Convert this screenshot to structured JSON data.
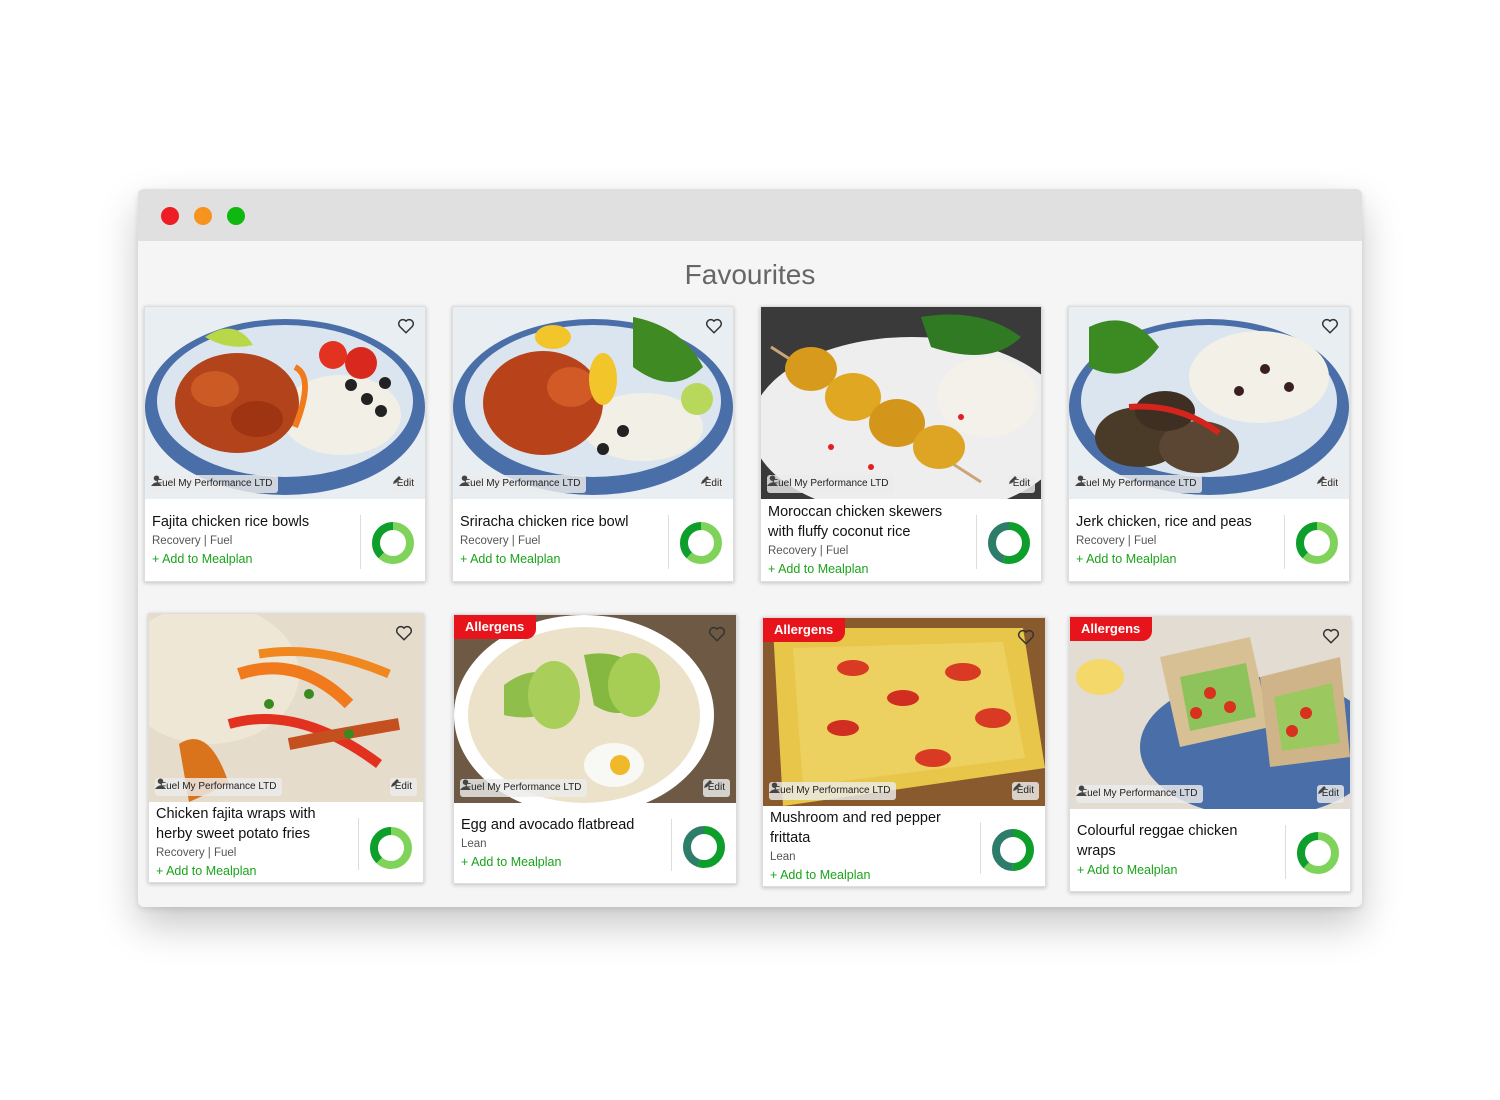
{
  "page": {
    "title": "Favourites"
  },
  "colors": {
    "accent_green": "#1aa31a",
    "allergen_red": "#e8141c",
    "donut_light": "#7fd35a",
    "donut_dark": "#0e9e2c",
    "donut_teal": "#2e7d6a"
  },
  "recipes": [
    {
      "title": "Fajita chicken rice bowls",
      "tags": "Recovery  |  Fuel",
      "author": "Fuel My Performance LTD",
      "edit": "Edit",
      "add": "+ Add to Mealplan",
      "favourite_icon": "heart-outline-icon",
      "nutrition_split": [
        0.62,
        0.38
      ]
    },
    {
      "title": "Sriracha chicken rice bowl",
      "tags": "Recovery  |  Fuel",
      "author": "Fuel My Performance LTD",
      "edit": "Edit",
      "add": "+ Add to Mealplan",
      "favourite_icon": "heart-outline-icon",
      "nutrition_split": [
        0.62,
        0.38
      ]
    },
    {
      "title": "Moroccan chicken skewers with fluffy coconut rice",
      "tags": "Recovery  |  Fuel",
      "author": "Fuel My Performance LTD",
      "edit": "Edit",
      "add": "+ Add to Mealplan",
      "favourite_icon": "heart-outline-icon",
      "nutrition_split": [
        0.55,
        0.45
      ]
    },
    {
      "title": "Jerk chicken, rice and peas",
      "tags": "Recovery  |  Fuel",
      "author": "Fuel My Performance LTD",
      "edit": "Edit",
      "add": "+ Add to Mealplan",
      "favourite_icon": "heart-outline-icon",
      "nutrition_split": [
        0.62,
        0.38
      ]
    },
    {
      "title": "Chicken fajita wraps with herby sweet potato fries",
      "tags": "Recovery  |  Fuel",
      "author": "Fuel My Performance LTD",
      "edit": "Edit",
      "add": "+ Add to Mealplan",
      "favourite_icon": "heart-outline-icon",
      "nutrition_split": [
        0.62,
        0.38
      ]
    },
    {
      "title": "Egg and avocado flatbread",
      "tags": "Lean",
      "author": "Fuel My Performance LTD",
      "edit": "Edit",
      "add": "+ Add to Mealplan",
      "allergens": "Allergens",
      "favourite_icon": "heart-outline-icon",
      "nutrition_split": [
        0.55,
        0.45
      ]
    },
    {
      "title": "Mushroom and red pepper frittata",
      "tags": "Lean",
      "author": "Fuel My Performance LTD",
      "edit": "Edit",
      "add": "+ Add to Mealplan",
      "allergens": "Allergens",
      "favourite_icon": "heart-outline-icon",
      "nutrition_split": [
        0.5,
        0.5
      ]
    },
    {
      "title": "Colourful reggae chicken wraps",
      "tags": "",
      "author": "Fuel My Performance LTD",
      "edit": "Edit",
      "add": "+ Add to Mealplan",
      "allergens": "Allergens",
      "favourite_icon": "heart-outline-icon",
      "nutrition_split": [
        0.62,
        0.38
      ]
    }
  ]
}
